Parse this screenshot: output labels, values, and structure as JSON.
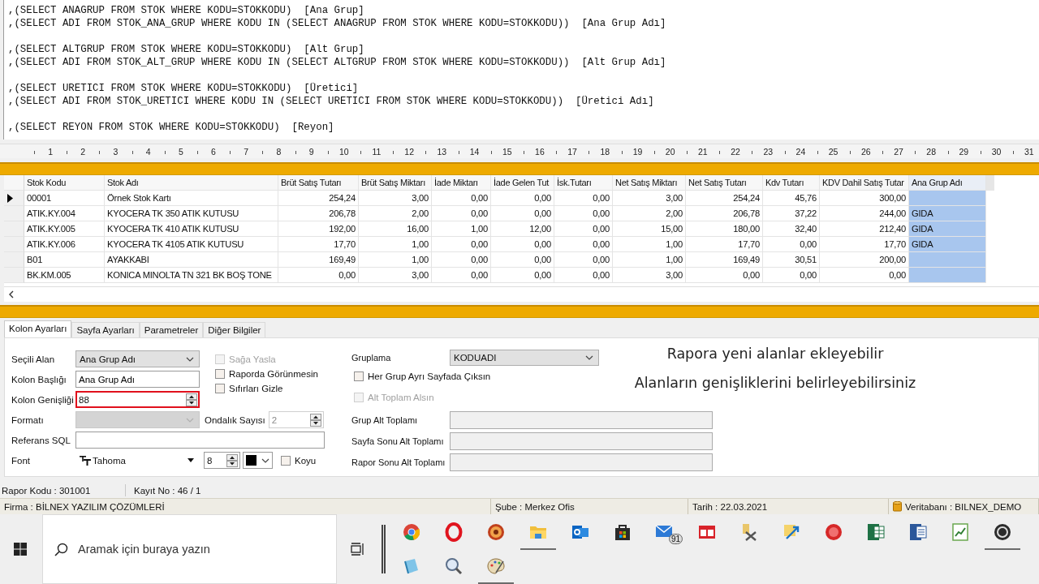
{
  "sql_editor": {
    "blocks": [
      [
        ",(SELECT ANAGRUP FROM STOK WHERE KODU=STOKKODU)  [Ana Grup]",
        ",(SELECT ADI FROM STOK_ANA_GRUP WHERE KODU IN (SELECT ANAGRUP FROM STOK WHERE KODU=STOKKODU))  [Ana Grup Adı]"
      ],
      [
        ",(SELECT ALTGRUP FROM STOK WHERE KODU=STOKKODU)  [Alt Grup]",
        ",(SELECT ADI FROM STOK_ALT_GRUP WHERE KODU IN (SELECT ALTGRUP FROM STOK WHERE KODU=STOKKODU))  [Alt Grup Adı]"
      ],
      [
        ",(SELECT URETICI FROM STOK WHERE KODU=STOKKODU)  [Üretici]",
        ",(SELECT ADI FROM STOK_URETICI WHERE KODU IN (SELECT URETICI FROM STOK WHERE KODU=STOKKODU))  [Üretici Adı]"
      ],
      [
        ",(SELECT REYON FROM STOK WHERE KODU=STOKKODU)  [Reyon]"
      ]
    ]
  },
  "ruler": [
    "1",
    "2",
    "3",
    "4",
    "5",
    "6",
    "7",
    "8",
    "9",
    "10",
    "11",
    "12",
    "13",
    "14",
    "15",
    "16",
    "17",
    "18",
    "19",
    "20",
    "21",
    "22",
    "23",
    "24",
    "25",
    "26",
    "27",
    "28",
    "29",
    "30",
    "31"
  ],
  "grid": {
    "columns": [
      {
        "label": "Stok Kodu",
        "kind": "text",
        "selected": false
      },
      {
        "label": "Stok Adı",
        "kind": "text",
        "selected": false
      },
      {
        "label": "Brüt Satış Tutarı",
        "kind": "number",
        "selected": false
      },
      {
        "label": "Brüt Satış Miktarı",
        "kind": "number",
        "selected": false
      },
      {
        "label": "İade Miktarı",
        "kind": "number",
        "selected": false
      },
      {
        "label": "İade Gelen Tut",
        "kind": "number",
        "selected": false
      },
      {
        "label": "İsk.Tutarı",
        "kind": "number",
        "selected": false
      },
      {
        "label": "Net Satış Miktarı",
        "kind": "number",
        "selected": false
      },
      {
        "label": "Net Satış Tutarı",
        "kind": "number",
        "selected": false
      },
      {
        "label": "Kdv Tutarı",
        "kind": "number",
        "selected": false
      },
      {
        "label": "KDV Dahil Satış Tutar",
        "kind": "number",
        "selected": false
      },
      {
        "label": "Ana Grup Adı",
        "kind": "text",
        "selected": true
      }
    ],
    "rows": [
      {
        "selected": true,
        "cells": [
          "00001",
          "Örnek Stok Kartı",
          "254,24",
          "3,00",
          "0,00",
          "0,00",
          "0,00",
          "3,00",
          "254,24",
          "45,76",
          "300,00",
          null
        ]
      },
      {
        "selected": false,
        "cells": [
          "ATIK.KY.004",
          "KYOCERA TK 350 ATIK KUTUSU",
          "206,78",
          "2,00",
          "0,00",
          "0,00",
          "0,00",
          "2,00",
          "206,78",
          "37,22",
          "244,00",
          "GIDA"
        ]
      },
      {
        "selected": false,
        "cells": [
          "ATIK.KY.005",
          "KYOCERA TK 410 ATIK KUTUSU",
          "192,00",
          "16,00",
          "1,00",
          "12,00",
          "0,00",
          "15,00",
          "180,00",
          "32,40",
          "212,40",
          "GIDA"
        ]
      },
      {
        "selected": false,
        "cells": [
          "ATIK.KY.006",
          "KYOCERA TK 4105 ATIK KUTUSU",
          "17,70",
          "1,00",
          "0,00",
          "0,00",
          "0,00",
          "1,00",
          "17,70",
          "0,00",
          "17,70",
          "GIDA"
        ]
      },
      {
        "selected": false,
        "cells": [
          "B01",
          "AYAKKABI",
          "169,49",
          "1,00",
          "0,00",
          "0,00",
          "0,00",
          "1,00",
          "169,49",
          "30,51",
          "200,00",
          null
        ]
      },
      {
        "selected": false,
        "cells": [
          "BK.KM.005",
          "KONICA MINOLTA TN 321 BK BOŞ TONE",
          "0,00",
          "3,00",
          "0,00",
          "0,00",
          "0,00",
          "3,00",
          "0,00",
          "0,00",
          "0,00",
          null
        ]
      }
    ]
  },
  "settings": {
    "tabs": [
      {
        "label": "Kolon Ayarları",
        "selected": true
      },
      {
        "label": "Sayfa Ayarları",
        "selected": false
      },
      {
        "label": "Parametreler",
        "selected": false
      },
      {
        "label": "Diğer Bilgiler",
        "selected": false
      }
    ],
    "selected_field": {
      "label": "Seçili Alan",
      "value": "Ana Grup Adı"
    },
    "column_title": {
      "label": "Kolon Başlığı",
      "value": "Ana Grup Adı"
    },
    "column_width": {
      "label": "Kolon Genişliği",
      "value": "88",
      "highlighted": true
    },
    "format": {
      "label": "Formatı",
      "disabled": true
    },
    "decimals": {
      "label": "Ondalık Sayısı",
      "value": "2",
      "disabled": true
    },
    "reference_sql": {
      "label": "Referans SQL"
    },
    "font": {
      "label": "Font",
      "name": "Tahoma",
      "size": "8"
    },
    "bold": {
      "label": "Koyu",
      "checked": false
    },
    "options": [
      {
        "label": "Sağa Yasla",
        "checked": false,
        "disabled": true
      },
      {
        "label": "Raporda Görünmesin",
        "checked": false,
        "disabled": false
      },
      {
        "label": "Sıfırları Gizle",
        "checked": false,
        "disabled": false
      }
    ],
    "grouping": {
      "label": "Gruplama",
      "value": "KODUADI"
    },
    "group_options": [
      {
        "label": "Her Grup Ayrı Sayfada Çıksın",
        "checked": false,
        "disabled": false
      },
      {
        "label": "Alt Toplam Alsın",
        "checked": false,
        "disabled": true
      }
    ],
    "totals": [
      {
        "label": "Grup Alt Toplamı",
        "disabled": true
      },
      {
        "label": "Sayfa Sonu Alt Toplamı",
        "disabled": true
      },
      {
        "label": "Rapor Sonu Alt Toplamı",
        "disabled": true
      }
    ]
  },
  "captions": [
    "Rapora yeni alanlar ekleyebilir",
    "Alanların genişliklerini belirleyebilirsiniz"
  ],
  "status_bar": [
    "Rapor Kodu : 301001",
    "Kayıt No : 46 / 1"
  ],
  "info_bar": [
    {
      "text": "Firma : BİLNEX YAZILIM ÇÖZÜMLERİ",
      "kind": "plain"
    },
    {
      "text": "Şube : Merkez Ofis",
      "kind": "plain"
    },
    {
      "text": "Tarih : 22.03.2021",
      "kind": "plain"
    },
    {
      "text": "Veritabanı : BILNEX_DEMO",
      "kind": "database"
    }
  ],
  "taskbar": {
    "search": {
      "placeholder": "Aramak için buraya yazın"
    },
    "apps": [
      {
        "kind": "globe",
        "running": false
      },
      {
        "kind": "ring",
        "running": false
      },
      {
        "kind": "disc",
        "running": false
      },
      {
        "kind": "folder",
        "running": true
      },
      {
        "kind": "mailapp",
        "running": false
      },
      {
        "kind": "bag",
        "running": false
      },
      {
        "kind": "mail",
        "running": false,
        "badge": "91"
      },
      {
        "kind": "window",
        "running": false
      },
      {
        "kind": "tools",
        "running": false
      },
      {
        "kind": "arrows",
        "running": false
      },
      {
        "kind": "roundlogo",
        "running": false
      },
      {
        "kind": "sheet",
        "running": false
      },
      {
        "kind": "doc",
        "running": false
      },
      {
        "kind": "chart",
        "running": false
      },
      {
        "kind": "darklogo",
        "running": true
      },
      {
        "kind": "notebook",
        "running": false
      },
      {
        "kind": "magnifier",
        "running": false
      },
      {
        "kind": "palette",
        "running": true
      }
    ]
  }
}
